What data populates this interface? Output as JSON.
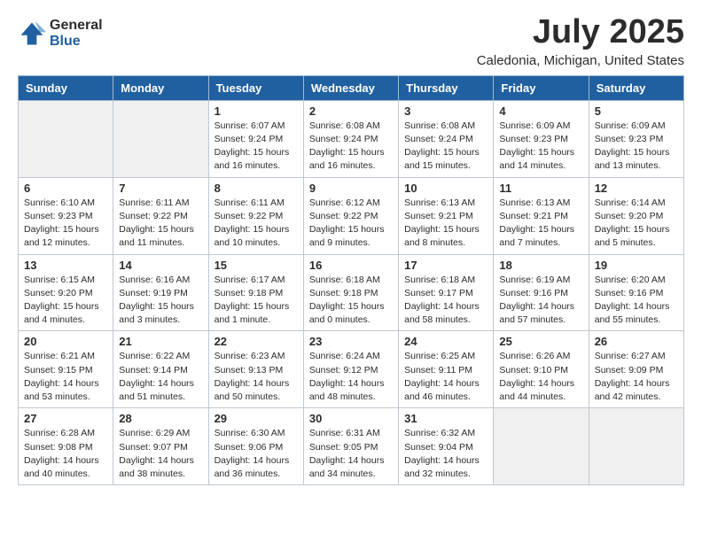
{
  "logo": {
    "general": "General",
    "blue": "Blue"
  },
  "title": "July 2025",
  "subtitle": "Caledonia, Michigan, United States",
  "days_of_week": [
    "Sunday",
    "Monday",
    "Tuesday",
    "Wednesday",
    "Thursday",
    "Friday",
    "Saturday"
  ],
  "weeks": [
    [
      {
        "day": "",
        "sunrise": "",
        "sunset": "",
        "daylight": "",
        "empty": true
      },
      {
        "day": "",
        "sunrise": "",
        "sunset": "",
        "daylight": "",
        "empty": true
      },
      {
        "day": "1",
        "sunrise": "Sunrise: 6:07 AM",
        "sunset": "Sunset: 9:24 PM",
        "daylight": "Daylight: 15 hours and 16 minutes."
      },
      {
        "day": "2",
        "sunrise": "Sunrise: 6:08 AM",
        "sunset": "Sunset: 9:24 PM",
        "daylight": "Daylight: 15 hours and 16 minutes."
      },
      {
        "day": "3",
        "sunrise": "Sunrise: 6:08 AM",
        "sunset": "Sunset: 9:24 PM",
        "daylight": "Daylight: 15 hours and 15 minutes."
      },
      {
        "day": "4",
        "sunrise": "Sunrise: 6:09 AM",
        "sunset": "Sunset: 9:23 PM",
        "daylight": "Daylight: 15 hours and 14 minutes."
      },
      {
        "day": "5",
        "sunrise": "Sunrise: 6:09 AM",
        "sunset": "Sunset: 9:23 PM",
        "daylight": "Daylight: 15 hours and 13 minutes."
      }
    ],
    [
      {
        "day": "6",
        "sunrise": "Sunrise: 6:10 AM",
        "sunset": "Sunset: 9:23 PM",
        "daylight": "Daylight: 15 hours and 12 minutes."
      },
      {
        "day": "7",
        "sunrise": "Sunrise: 6:11 AM",
        "sunset": "Sunset: 9:22 PM",
        "daylight": "Daylight: 15 hours and 11 minutes."
      },
      {
        "day": "8",
        "sunrise": "Sunrise: 6:11 AM",
        "sunset": "Sunset: 9:22 PM",
        "daylight": "Daylight: 15 hours and 10 minutes."
      },
      {
        "day": "9",
        "sunrise": "Sunrise: 6:12 AM",
        "sunset": "Sunset: 9:22 PM",
        "daylight": "Daylight: 15 hours and 9 minutes."
      },
      {
        "day": "10",
        "sunrise": "Sunrise: 6:13 AM",
        "sunset": "Sunset: 9:21 PM",
        "daylight": "Daylight: 15 hours and 8 minutes."
      },
      {
        "day": "11",
        "sunrise": "Sunrise: 6:13 AM",
        "sunset": "Sunset: 9:21 PM",
        "daylight": "Daylight: 15 hours and 7 minutes."
      },
      {
        "day": "12",
        "sunrise": "Sunrise: 6:14 AM",
        "sunset": "Sunset: 9:20 PM",
        "daylight": "Daylight: 15 hours and 5 minutes."
      }
    ],
    [
      {
        "day": "13",
        "sunrise": "Sunrise: 6:15 AM",
        "sunset": "Sunset: 9:20 PM",
        "daylight": "Daylight: 15 hours and 4 minutes."
      },
      {
        "day": "14",
        "sunrise": "Sunrise: 6:16 AM",
        "sunset": "Sunset: 9:19 PM",
        "daylight": "Daylight: 15 hours and 3 minutes."
      },
      {
        "day": "15",
        "sunrise": "Sunrise: 6:17 AM",
        "sunset": "Sunset: 9:18 PM",
        "daylight": "Daylight: 15 hours and 1 minute."
      },
      {
        "day": "16",
        "sunrise": "Sunrise: 6:18 AM",
        "sunset": "Sunset: 9:18 PM",
        "daylight": "Daylight: 15 hours and 0 minutes."
      },
      {
        "day": "17",
        "sunrise": "Sunrise: 6:18 AM",
        "sunset": "Sunset: 9:17 PM",
        "daylight": "Daylight: 14 hours and 58 minutes."
      },
      {
        "day": "18",
        "sunrise": "Sunrise: 6:19 AM",
        "sunset": "Sunset: 9:16 PM",
        "daylight": "Daylight: 14 hours and 57 minutes."
      },
      {
        "day": "19",
        "sunrise": "Sunrise: 6:20 AM",
        "sunset": "Sunset: 9:16 PM",
        "daylight": "Daylight: 14 hours and 55 minutes."
      }
    ],
    [
      {
        "day": "20",
        "sunrise": "Sunrise: 6:21 AM",
        "sunset": "Sunset: 9:15 PM",
        "daylight": "Daylight: 14 hours and 53 minutes."
      },
      {
        "day": "21",
        "sunrise": "Sunrise: 6:22 AM",
        "sunset": "Sunset: 9:14 PM",
        "daylight": "Daylight: 14 hours and 51 minutes."
      },
      {
        "day": "22",
        "sunrise": "Sunrise: 6:23 AM",
        "sunset": "Sunset: 9:13 PM",
        "daylight": "Daylight: 14 hours and 50 minutes."
      },
      {
        "day": "23",
        "sunrise": "Sunrise: 6:24 AM",
        "sunset": "Sunset: 9:12 PM",
        "daylight": "Daylight: 14 hours and 48 minutes."
      },
      {
        "day": "24",
        "sunrise": "Sunrise: 6:25 AM",
        "sunset": "Sunset: 9:11 PM",
        "daylight": "Daylight: 14 hours and 46 minutes."
      },
      {
        "day": "25",
        "sunrise": "Sunrise: 6:26 AM",
        "sunset": "Sunset: 9:10 PM",
        "daylight": "Daylight: 14 hours and 44 minutes."
      },
      {
        "day": "26",
        "sunrise": "Sunrise: 6:27 AM",
        "sunset": "Sunset: 9:09 PM",
        "daylight": "Daylight: 14 hours and 42 minutes."
      }
    ],
    [
      {
        "day": "27",
        "sunrise": "Sunrise: 6:28 AM",
        "sunset": "Sunset: 9:08 PM",
        "daylight": "Daylight: 14 hours and 40 minutes."
      },
      {
        "day": "28",
        "sunrise": "Sunrise: 6:29 AM",
        "sunset": "Sunset: 9:07 PM",
        "daylight": "Daylight: 14 hours and 38 minutes."
      },
      {
        "day": "29",
        "sunrise": "Sunrise: 6:30 AM",
        "sunset": "Sunset: 9:06 PM",
        "daylight": "Daylight: 14 hours and 36 minutes."
      },
      {
        "day": "30",
        "sunrise": "Sunrise: 6:31 AM",
        "sunset": "Sunset: 9:05 PM",
        "daylight": "Daylight: 14 hours and 34 minutes."
      },
      {
        "day": "31",
        "sunrise": "Sunrise: 6:32 AM",
        "sunset": "Sunset: 9:04 PM",
        "daylight": "Daylight: 14 hours and 32 minutes."
      },
      {
        "day": "",
        "sunrise": "",
        "sunset": "",
        "daylight": "",
        "empty": true
      },
      {
        "day": "",
        "sunrise": "",
        "sunset": "",
        "daylight": "",
        "empty": true
      }
    ]
  ]
}
